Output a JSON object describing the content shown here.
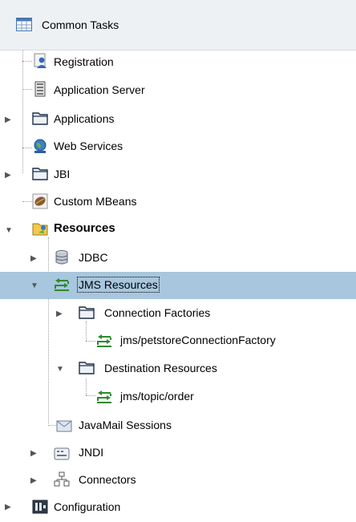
{
  "header": {
    "title": "Common Tasks",
    "icon": "table-icon"
  },
  "tree": [
    {
      "label": "Registration",
      "icon": "registration-icon",
      "expanded": null
    },
    {
      "label": "Application Server",
      "icon": "server-icon",
      "expanded": null
    },
    {
      "label": "Applications",
      "icon": "folder-icon",
      "expanded": false
    },
    {
      "label": "Web Services",
      "icon": "globe-icon",
      "expanded": null
    },
    {
      "label": "JBI",
      "icon": "folder-icon",
      "expanded": false
    },
    {
      "label": "Custom MBeans",
      "icon": "bean-icon",
      "expanded": null
    },
    {
      "label": "Resources",
      "icon": "resources-folder-icon",
      "expanded": true
    },
    {
      "label": "JDBC",
      "icon": "database-icon",
      "expanded": false
    },
    {
      "label": "JMS Resources",
      "icon": "jms-icon",
      "expanded": true,
      "selected": true
    },
    {
      "label": "Connection Factories",
      "icon": "folder-icon",
      "expanded": false
    },
    {
      "label": "jms/petstoreConnectionFactory",
      "icon": "jms-icon",
      "expanded": null
    },
    {
      "label": "Destination Resources",
      "icon": "folder-icon",
      "expanded": true
    },
    {
      "label": "jms/topic/order",
      "icon": "jms-icon",
      "expanded": null
    },
    {
      "label": "JavaMail Sessions",
      "icon": "mail-icon",
      "expanded": null
    },
    {
      "label": "JNDI",
      "icon": "jndi-icon",
      "expanded": false
    },
    {
      "label": "Connectors",
      "icon": "connector-icon",
      "expanded": false
    },
    {
      "label": "Configuration",
      "icon": "configuration-icon",
      "expanded": false
    }
  ]
}
